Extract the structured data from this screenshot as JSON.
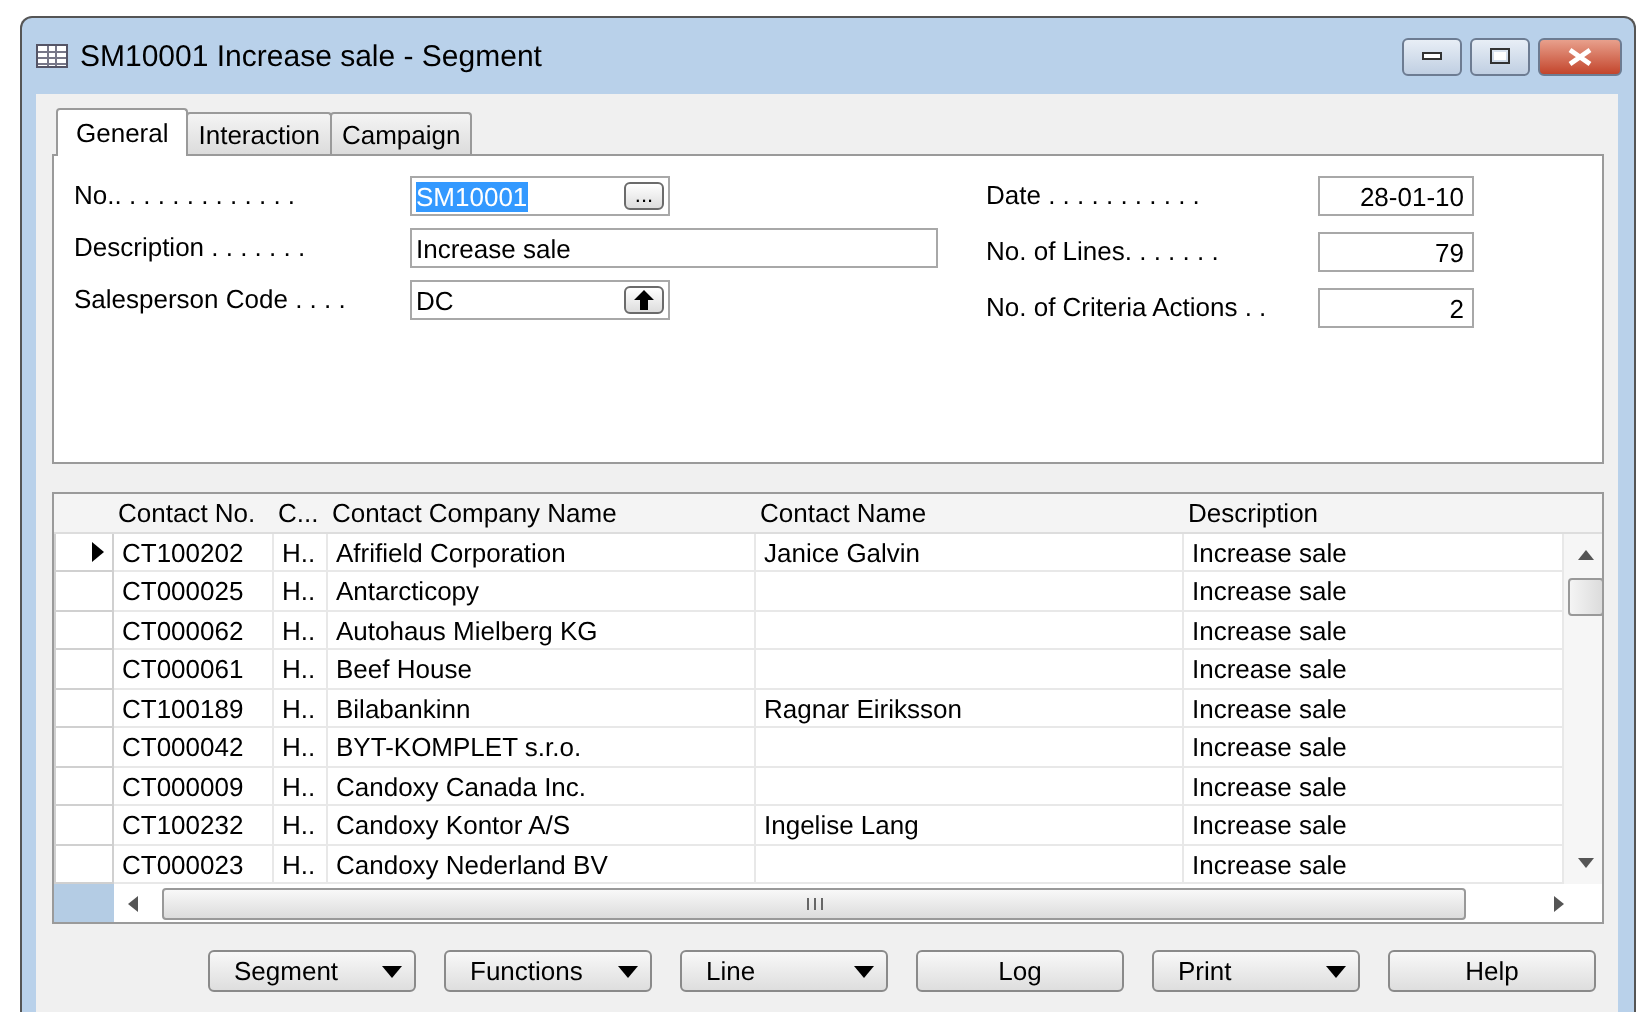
{
  "window": {
    "title": "SM10001 Increase sale - Segment"
  },
  "tabs": [
    {
      "label": "General",
      "selected": true
    },
    {
      "label": "Interaction",
      "selected": false
    },
    {
      "label": "Campaign",
      "selected": false
    }
  ],
  "general": {
    "left_fields": [
      {
        "label": "No.. . . . . . . . . . . . .",
        "value": "SM10001",
        "kind": "lookup",
        "button": "...",
        "value_selected": true
      },
      {
        "label": "Description . . . . . . .",
        "value": "Increase sale",
        "kind": "text",
        "value_selected": false
      },
      {
        "label": "Salesperson Code . . . .",
        "value": "DC",
        "kind": "drilldown",
        "value_selected": false
      }
    ],
    "right_fields": [
      {
        "label": "Date . . . . . . . . . . .",
        "value": "28-01-10"
      },
      {
        "label": "No. of Lines. . . . . . .",
        "value": "79"
      },
      {
        "label": "No. of Criteria Actions . .",
        "value": "2"
      }
    ]
  },
  "table": {
    "columns": [
      "Contact No.",
      "C...",
      "Contact Company Name",
      "Contact Name",
      "Description"
    ],
    "rows": [
      {
        "cells": [
          "CT100202",
          "H..",
          "Afrifield Corporation",
          "Janice Galvin",
          "Increase sale"
        ],
        "selected": true
      },
      {
        "cells": [
          "CT000025",
          "H..",
          "Antarcticopy",
          "",
          "Increase sale"
        ],
        "selected": false
      },
      {
        "cells": [
          "CT000062",
          "H..",
          "Autohaus Mielberg KG",
          "",
          "Increase sale"
        ],
        "selected": false
      },
      {
        "cells": [
          "CT000061",
          "H..",
          "Beef House",
          "",
          "Increase sale"
        ],
        "selected": false
      },
      {
        "cells": [
          "CT100189",
          "H..",
          "Bilabankinn",
          "Ragnar Eiriksson",
          "Increase sale"
        ],
        "selected": false
      },
      {
        "cells": [
          "CT000042",
          "H..",
          "BYT-KOMPLET s.r.o.",
          "",
          "Increase sale"
        ],
        "selected": false
      },
      {
        "cells": [
          "CT000009",
          "H..",
          "Candoxy Canada Inc.",
          "",
          "Increase sale"
        ],
        "selected": false
      },
      {
        "cells": [
          "CT100232",
          "H..",
          "Candoxy Kontor A/S",
          "Ingelise Lang",
          "Increase sale"
        ],
        "selected": false
      },
      {
        "cells": [
          "CT000023",
          "H..",
          "Candoxy Nederland BV",
          "",
          "Increase sale"
        ],
        "selected": false
      }
    ]
  },
  "buttons": [
    {
      "label": "Segment",
      "has_menu": true
    },
    {
      "label": "Functions",
      "has_menu": true
    },
    {
      "label": "Line",
      "has_menu": true
    },
    {
      "label": "Log",
      "has_menu": false
    },
    {
      "label": "Print",
      "has_menu": true
    },
    {
      "label": "Help",
      "has_menu": false
    }
  ]
}
